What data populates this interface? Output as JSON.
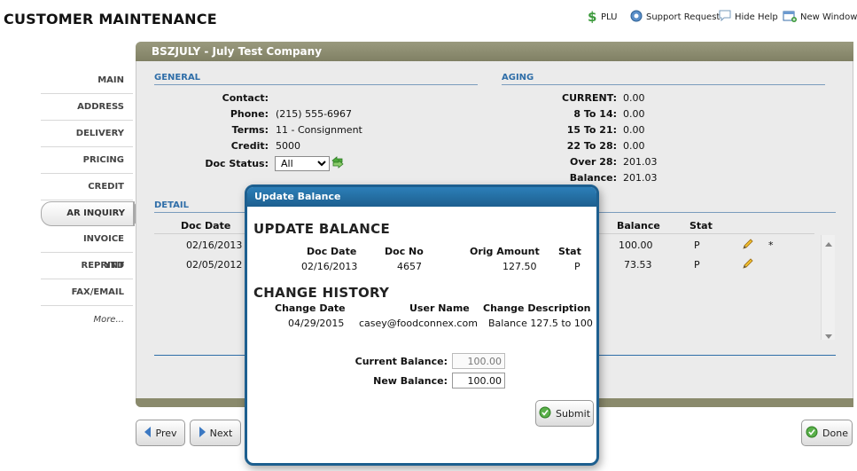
{
  "header": {
    "title": "CUSTOMER MAINTENANCE",
    "links": {
      "plu": "PLU",
      "support": "Support Request",
      "hide_help": "Hide Help",
      "new_window": "New Window"
    }
  },
  "sidebar": {
    "items": [
      {
        "label": "MAIN"
      },
      {
        "label": "ADDRESS"
      },
      {
        "label": "DELIVERY"
      },
      {
        "label": "PRICING"
      },
      {
        "label": "CREDIT"
      },
      {
        "label": "AR INQUIRY",
        "active": true
      },
      {
        "label": "INVOICE REPRINT"
      },
      {
        "label": "YTD"
      },
      {
        "label": "FAX/EMAIL"
      },
      {
        "label": "More..."
      }
    ]
  },
  "company": {
    "name": "BSZJULY - July Test Company"
  },
  "general": {
    "heading": "GENERAL",
    "contact_label": "Contact:",
    "contact_value": "",
    "phone_label": "Phone:",
    "phone_value": "(215) 555-6967",
    "terms_label": "Terms:",
    "terms_value": "11 - Consignment",
    "credit_label": "Credit:",
    "credit_value": "5000",
    "doc_status_label": "Doc Status:",
    "doc_status_value": "All"
  },
  "aging": {
    "heading": "AGING",
    "current_label": "CURRENT:",
    "current_value": "0.00",
    "b8_14_label": "8 To 14:",
    "b8_14_value": "0.00",
    "b15_21_label": "15 To 21:",
    "b15_21_value": "0.00",
    "b22_28_label": "22 To 28:",
    "b22_28_value": "0.00",
    "over28_label": "Over 28:",
    "over28_value": "201.03",
    "balance_label": "Balance:",
    "balance_value": "201.03"
  },
  "detail": {
    "heading": "DETAIL",
    "columns": {
      "doc_date": "Doc Date",
      "balance": "Balance",
      "stat": "Stat"
    },
    "rows": [
      {
        "doc_date": "02/16/2013",
        "balance": "100.00",
        "stat": "P",
        "flag": "*"
      },
      {
        "doc_date": "02/05/2012",
        "balance": "73.53",
        "stat": "P",
        "flag": ""
      }
    ]
  },
  "nav_buttons": {
    "prev": "Prev",
    "next": "Next",
    "done": "Done"
  },
  "modal": {
    "title": "Update Balance",
    "update_heading": "UPDATE BALANCE",
    "columns": {
      "doc_date": "Doc Date",
      "doc_no": "Doc No",
      "orig_amount": "Orig Amount",
      "stat": "Stat"
    },
    "row": {
      "doc_date": "02/16/2013",
      "doc_no": "4657",
      "orig_amount": "127.50",
      "stat": "P"
    },
    "history_heading": "CHANGE HISTORY",
    "history_columns": {
      "change_date": "Change Date",
      "user_name": "User Name",
      "change_description": "Change Description"
    },
    "history_row": {
      "change_date": "04/29/2015",
      "user_name": "casey@foodconnex.com",
      "change_description": "Balance 127.5 to 100"
    },
    "current_balance_label": "Current Balance:",
    "current_balance_value": "100.00",
    "new_balance_label": "New Balance:",
    "new_balance_value": "100.00",
    "submit_label": "Submit"
  },
  "colors": {
    "accent_blue": "#1d5f8f",
    "bar_olive": "#8a8a6c",
    "section_blue": "#2f6ea8"
  }
}
